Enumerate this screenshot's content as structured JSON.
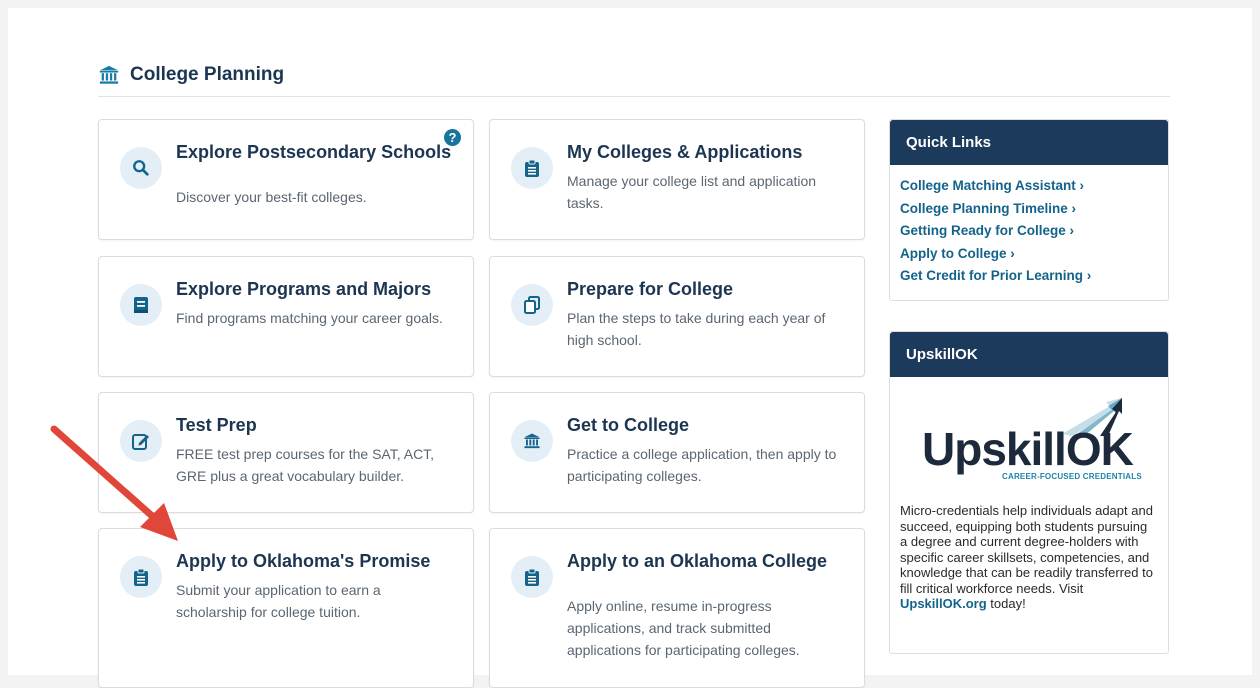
{
  "section": {
    "title": "College Planning",
    "icon": "institution-icon"
  },
  "cards": [
    {
      "title": "Explore Postsecondary Schools",
      "desc": "Discover your best-fit colleges.",
      "icon": "search-icon",
      "help": "?"
    },
    {
      "title": "My Colleges & Applications",
      "desc": "Manage your college list and application tasks.",
      "icon": "clipboard-icon"
    },
    {
      "title": "Explore Programs and Majors",
      "desc": "Find programs matching your career goals.",
      "icon": "book-icon"
    },
    {
      "title": "Prepare for College",
      "desc": "Plan the steps to take during each year of high school.",
      "icon": "copy-icon"
    },
    {
      "title": "Test Prep",
      "desc": "FREE test prep courses for the SAT, ACT, GRE plus a great vocabulary builder.",
      "icon": "edit-icon"
    },
    {
      "title": "Get to College",
      "desc": "Practice a college application, then apply to participating colleges.",
      "icon": "institution-icon"
    },
    {
      "title": "Apply to Oklahoma's Promise",
      "desc": "Submit your application to earn a scholarship for college tuition.",
      "icon": "clipboard-icon"
    },
    {
      "title": "Apply to an Oklahoma College",
      "desc": "Apply online, resume in-progress applications, and track submitted applications for participating colleges.",
      "icon": "clipboard-icon"
    }
  ],
  "quick_links": {
    "title": "Quick Links",
    "links": [
      "College Matching Assistant ›",
      "College Planning Timeline ›",
      "Getting Ready for College ›",
      "Apply to College ›",
      "Get Credit for Prior Learning ›"
    ]
  },
  "upskill": {
    "title": "UpskillOK",
    "logo_text": "UpskillOK",
    "logo_tagline": "CAREER-FOCUSED CREDENTIALS",
    "desc": "Micro-credentials help individuals adapt and succeed, equipping both students pursuing a degree and current degree-holders with specific career skillsets, competencies, and knowledge that can be readily transferred to fill critical workforce needs. Visit ",
    "link": "UpskillOK.org",
    "desc_end": " today!"
  },
  "colors": {
    "navy": "#1c3a5b",
    "link": "#13638a",
    "arrow": "#e0463a",
    "icon_bg": "#e4eef6"
  }
}
